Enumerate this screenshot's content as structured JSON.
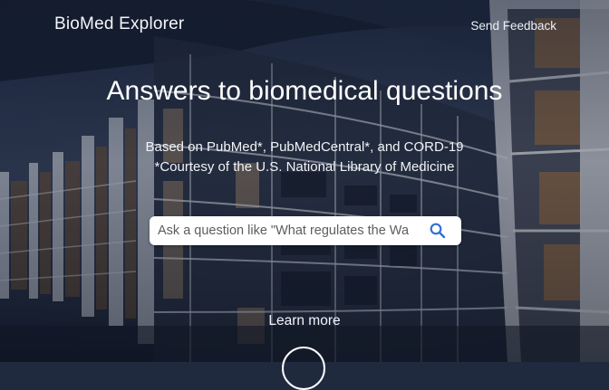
{
  "header": {
    "brand": "BioMed Explorer",
    "feedback_label": "Send Feedback"
  },
  "hero": {
    "title": "Answers to biomedical questions",
    "subtitle_line1": "Based on PubMed*, PubMedCentral*, and CORD-19",
    "subtitle_line2": "*Courtesy of the U.S. National Library of Medicine"
  },
  "search": {
    "placeholder": "Ask a question like \"What regulates the Wa",
    "icon": "search-icon"
  },
  "learn_more": {
    "label": "Learn more",
    "icon": "chevron-down-icon"
  },
  "colors": {
    "search_icon": "#2f6fd6",
    "background": "#1f2a3e"
  }
}
